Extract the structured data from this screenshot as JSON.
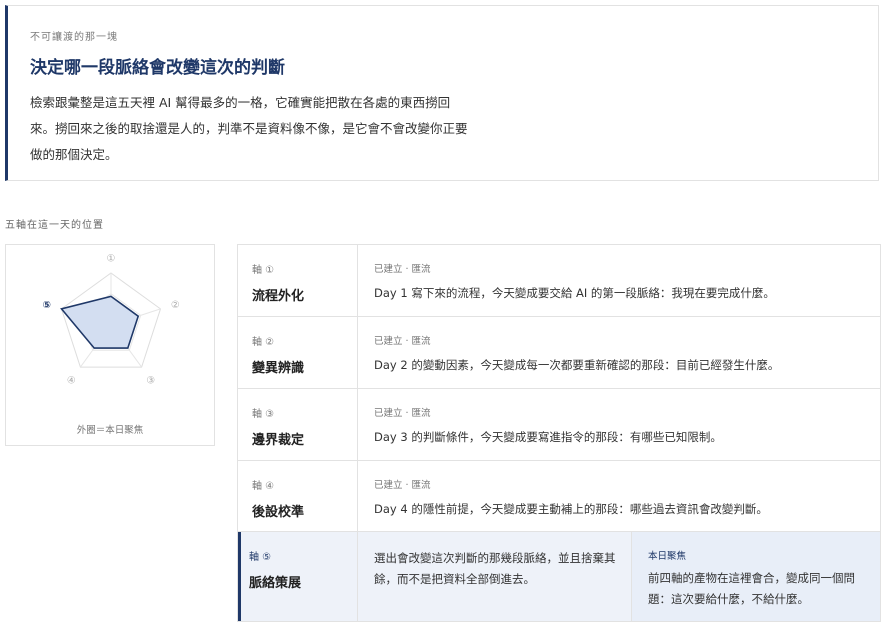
{
  "callout": {
    "eyebrow": "不可讓渡的那一塊",
    "title": "決定哪一段脈絡會改變這次的判斷",
    "body": "檢索跟彙整是這五天裡 AI 幫得最多的一格，它確實能把散在各處的東西撈回來。撈回來之後的取捨還是人的，判準不是資料像不像，是它會不會改變你正要做的那個決定。"
  },
  "radar": {
    "section_label": "五軸在這一天的位置",
    "caption": "外圈＝本日聚焦",
    "axis_markers": [
      "①",
      "②",
      "③",
      "④",
      "⑤"
    ],
    "levels": [
      0.55,
      0.55,
      0.55,
      0.55,
      1.0
    ],
    "focus_index": 4,
    "accent_color": "#1f3868",
    "fill_color": "#d3def1"
  },
  "rows": [
    {
      "axis_no": "軸 ①",
      "name": "流程外化",
      "status": "已建立 · 匯流",
      "desc": "Day 1 寫下來的流程，今天變成要交給 AI 的第一段脈絡：我現在要完成什麼。"
    },
    {
      "axis_no": "軸 ②",
      "name": "變異辨識",
      "status": "已建立 · 匯流",
      "desc": "Day 2 的變動因素，今天變成每一次都要重新確認的那段：目前已經發生什麼。"
    },
    {
      "axis_no": "軸 ③",
      "name": "邊界裁定",
      "status": "已建立 · 匯流",
      "desc": "Day 3 的判斷條件，今天變成要寫進指令的那段：有哪些已知限制。"
    },
    {
      "axis_no": "軸 ④",
      "name": "後設校準",
      "status": "已建立 · 匯流",
      "desc": "Day 4 的隱性前提，今天變成要主動補上的那段：哪些過去資訊會改變判斷。"
    }
  ],
  "focus_row": {
    "axis_no": "軸 ⑤",
    "name": "脈絡策展",
    "desc": "選出會改變這次判斷的那幾段脈絡，並且捨棄其餘，而不是把資料全部倒進去。",
    "label": "本日聚焦",
    "note": "前四軸的產物在這裡會合，變成同一個問題：這次要給什麼，不給什麼。"
  }
}
